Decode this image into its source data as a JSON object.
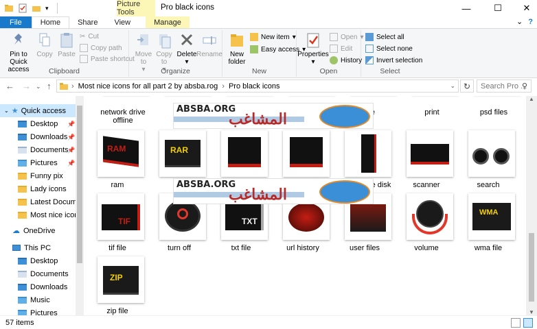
{
  "window": {
    "context_tab_group": "Picture Tools",
    "title": "Pro black icons",
    "minimize": "—",
    "maximize": "☐",
    "close": "✕"
  },
  "tabs": [
    "File",
    "Home",
    "Share",
    "View",
    "Manage"
  ],
  "ribbon": {
    "clipboard": {
      "label": "Clipboard",
      "pin": "Pin to Quick access",
      "copy": "Copy",
      "paste": "Paste",
      "cut": "Cut",
      "copy_path": "Copy path",
      "paste_shortcut": "Paste shortcut"
    },
    "organize": {
      "label": "Organize",
      "move_to": "Move to",
      "copy_to": "Copy to",
      "delete": "Delete",
      "rename": "Rename"
    },
    "new": {
      "label": "New",
      "new_folder": "New folder",
      "new_item": "New item",
      "easy_access": "Easy access"
    },
    "open": {
      "label": "Open",
      "properties": "Properties",
      "open": "Open",
      "edit": "Edit",
      "history": "History"
    },
    "select": {
      "label": "Select",
      "select_all": "Select all",
      "select_none": "Select none",
      "invert": "Invert selection"
    }
  },
  "address": {
    "path": [
      "Most nice icons for all part 2 by absba.rog",
      "Pro black icons"
    ],
    "separator": "›",
    "search_placeholder": "Search Pro ..."
  },
  "nav": {
    "quick_access": "Quick access",
    "items": [
      "Desktop",
      "Downloads",
      "Documents",
      "Pictures",
      "Funny pix",
      "Lady icons",
      "Latest Documents",
      "Most nice icons f"
    ],
    "onedrive": "OneDrive",
    "this_pc": "This PC",
    "pc_items": [
      "Desktop",
      "Documents",
      "Downloads",
      "Music",
      "Pictures"
    ]
  },
  "files": {
    "row0": [
      "network drive offline",
      "",
      "",
      "",
      "file",
      "print",
      "psd files"
    ],
    "row1": [
      "ram",
      "",
      "",
      "",
      "e disk",
      "scanner",
      "search"
    ],
    "row2": [
      "tif file",
      "turn off",
      "txt file",
      "url history",
      "user files",
      "volume",
      "wma file"
    ],
    "row3": [
      "zip file"
    ]
  },
  "icon_texts": {
    "ram": "RAM",
    "rar": "RAR",
    "tif": "TIF",
    "txt": "TXT",
    "wma": "WMA",
    "zip": "ZIP"
  },
  "watermark": {
    "text": "ABSBA.ORG",
    "arabic": "المشاغب"
  },
  "status": {
    "count": "57 items"
  }
}
